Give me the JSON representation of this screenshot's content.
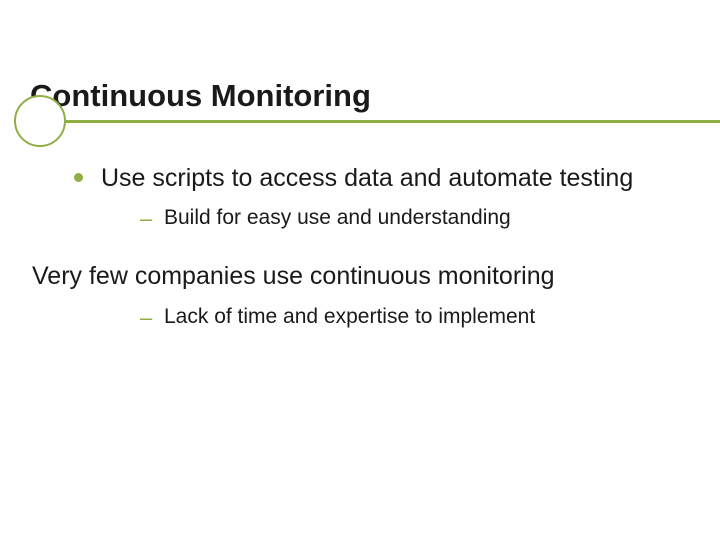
{
  "title": "Continuous Monitoring",
  "bullets": [
    {
      "text": "Use scripts to access data and automate testing",
      "subs": [
        {
          "text": "Build for easy use and understanding"
        }
      ]
    }
  ],
  "plain": {
    "text": "Very few companies use continuous monitoring",
    "subs": [
      {
        "text": "Lack of time and expertise to implement"
      }
    ]
  }
}
